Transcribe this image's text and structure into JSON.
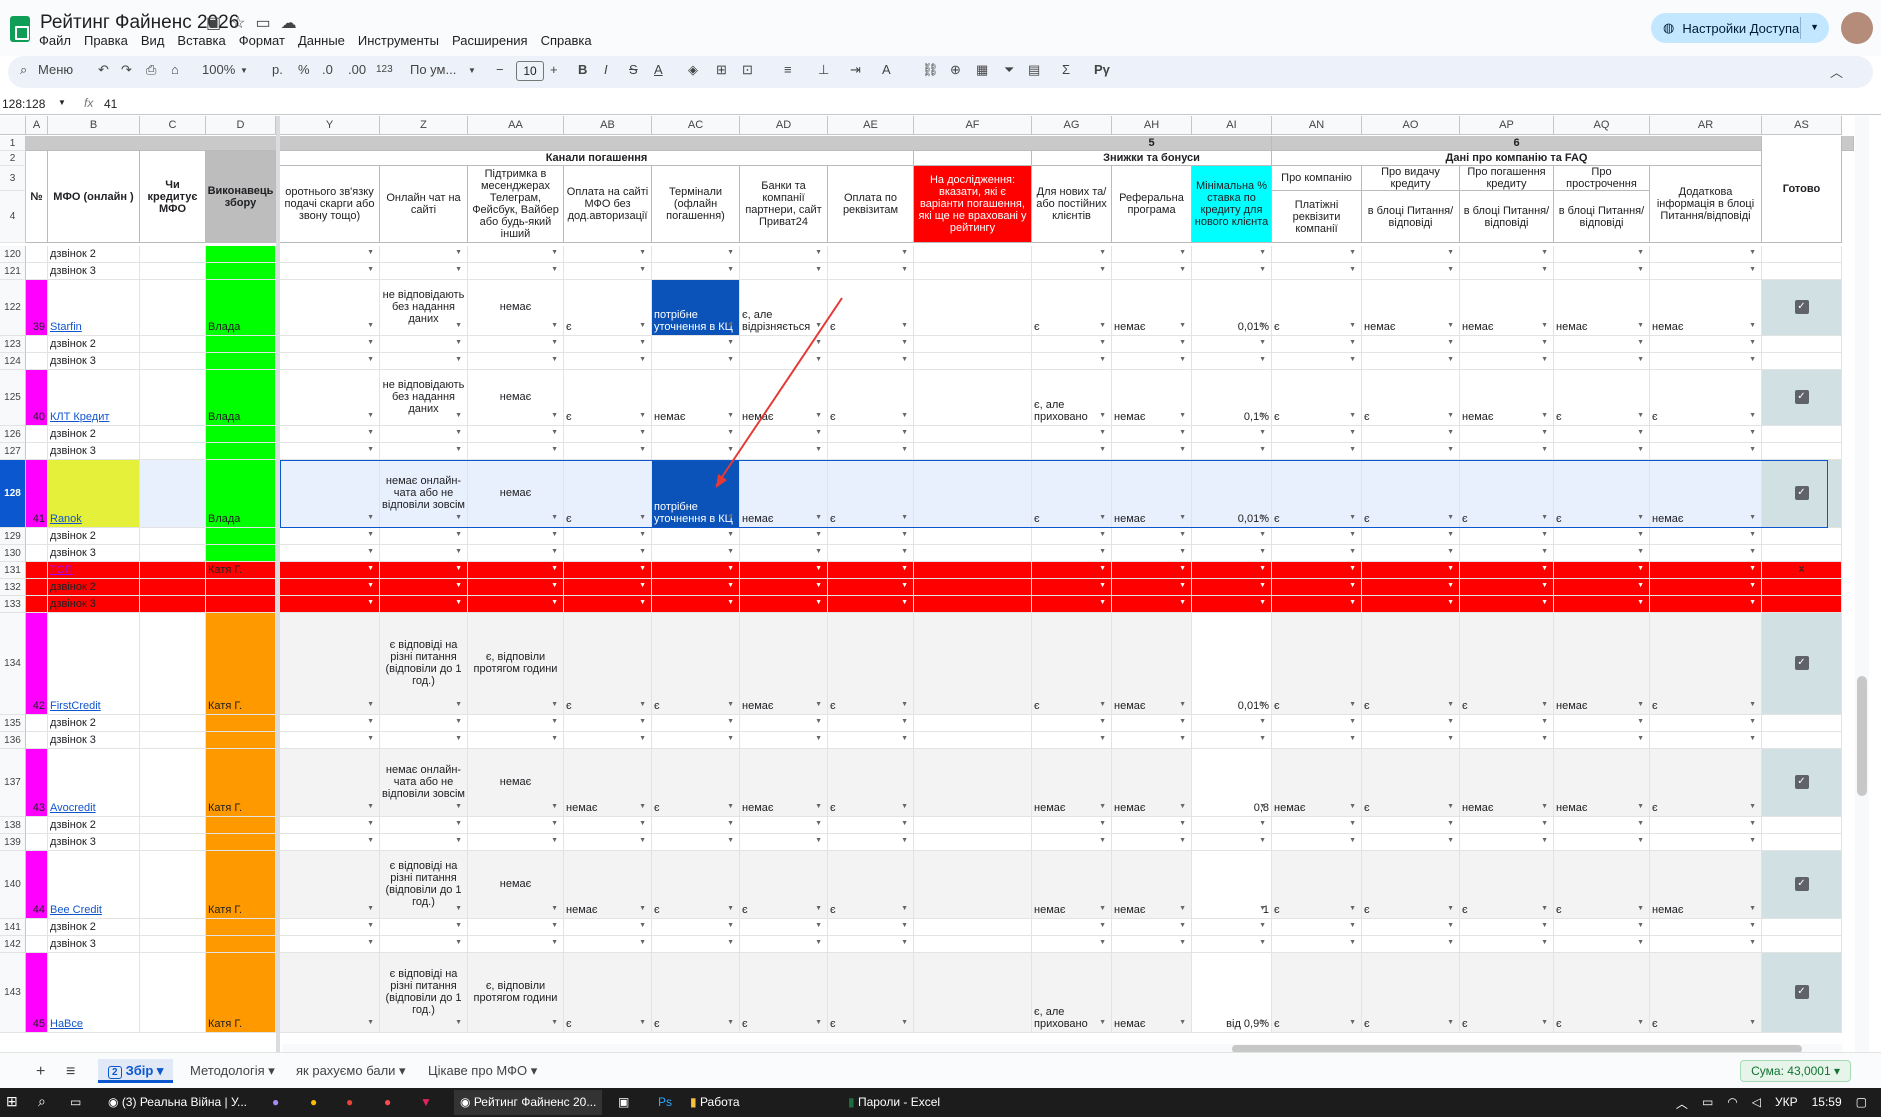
{
  "app": {
    "title": "Рейтинг Файненс 2026",
    "menus": [
      "Файл",
      "Правка",
      "Вид",
      "Вставка",
      "Формат",
      "Данные",
      "Инструменты",
      "Расширения",
      "Справка"
    ],
    "share_label": "Настройки Доступа"
  },
  "toolbar": {
    "search": "Меню",
    "zoom": "100%",
    "currency": "р.",
    "percent": "%",
    "dec_less": ".0",
    "dec_more": ".00",
    "num_format": "123",
    "font": "По ум...",
    "font_size": "10",
    "script_label": "Pγ"
  },
  "formula": {
    "namebox": "128:128",
    "fx": "fx",
    "value": "41"
  },
  "columns": [
    "A",
    "B",
    "C",
    "D",
    "Y",
    "Z",
    "AA",
    "AB",
    "AC",
    "AD",
    "AE",
    "AF",
    "AG",
    "AH",
    "AI",
    "AN",
    "AO",
    "AP",
    "AQ",
    "AR",
    "AS"
  ],
  "header": {
    "row1_5": "5",
    "row1_6": "6",
    "group_channels": "Канали погашення",
    "group_discounts": "Знижки та бонуси",
    "group_company": "Дані про компанію та FAQ",
    "num": "№",
    "mfo": "МФО (онлайн )",
    "credit": "Чи кредитує МФО",
    "executor": "Виконавець збору",
    "y": "оротнього зв'язку подачі скарги або звону тощо)",
    "z": "Онлайн чат на сайті",
    "aa": "Підтримка в месенджерах Телеграм, Фейсбук, Вайбер або будь-який інший",
    "ab": "Оплата на сайті МФО без дод.авторизації",
    "ac": "Термінали (офлайн погашення)",
    "ad": "Банки та компанії партнери, сайт Приват24",
    "ae": "Оплата по реквізитам",
    "af": "На дослідження: вказати, які є варіанти погашення, які ще не враховані у рейтингу",
    "ag": "Для нових та/або постійних клієнтів",
    "ah": "Реферальна програма",
    "ai": "Мінімальна % ставка по кредиту для нового клієнта",
    "an_top": "Про компанію",
    "an_bot": "Платіжні реквізити компанії",
    "ao_top": "Про видачу кредиту",
    "ao_bot": "в блоці Питання/відповіді",
    "ap_top": "Про погашення кредиту",
    "ap_bot": "в блоці Питання/відповіді",
    "aq_top": "Про прострочення",
    "aq_bot": "в блоці Питання/відповіді",
    "ar": "Додаткова інформація в блоці Питання/відповіді",
    "as": "Готово"
  },
  "rows": [
    {
      "n": "120",
      "b": "дзвінок 2"
    },
    {
      "n": "121",
      "b": "дзвінок 3"
    },
    {
      "n": "122",
      "a": "39",
      "b": "Starfin",
      "d": "Влада",
      "z": "не відповідають без надання даних",
      "aa": "немає",
      "ab": "є",
      "ac": "потрібне уточнення в КЦ",
      "ad": "є, але відрізняється",
      "ae": "є",
      "ag": "є",
      "ah": "немає",
      "ai": "0,01%",
      "an": "є",
      "ao": "немає",
      "ap": "немає",
      "aq": "немає",
      "ar": "немає"
    },
    {
      "n": "123",
      "b": "дзвінок 2"
    },
    {
      "n": "124",
      "b": "дзвінок 3"
    },
    {
      "n": "125",
      "a": "40",
      "b": "КЛТ Кредит",
      "d": "Влада",
      "z": "не відповідають без надання даних",
      "aa": "немає",
      "ab": "є",
      "ac": "немає",
      "ad": "немає",
      "ae": "є",
      "ag": "є, але приховано",
      "ah": "немає",
      "ai": "0,1%",
      "an": "є",
      "ao": "є",
      "ap": "немає",
      "aq": "є",
      "ar": "є"
    },
    {
      "n": "126",
      "b": "дзвінок 2"
    },
    {
      "n": "127",
      "b": "дзвінок 3"
    },
    {
      "n": "128",
      "a": "41",
      "b": "Ranok",
      "d": "Влада",
      "z": "немає онлайн-чата або не відповіли зовсім",
      "aa": "немає",
      "ab": "є",
      "ac": "потрібне уточнення в КЦ",
      "ad": "немає",
      "ae": "є",
      "ag": "є",
      "ah": "немає",
      "ai": "0,01%",
      "an": "є",
      "ao": "є",
      "ap": "є",
      "aq": "є",
      "ar": "немає"
    },
    {
      "n": "129",
      "b": "дзвінок 2"
    },
    {
      "n": "130",
      "b": "дзвінок 3"
    },
    {
      "n": "131",
      "b": "ТОП",
      "d": "Катя Г.",
      "as": "x"
    },
    {
      "n": "132",
      "b": "дзвінок 2"
    },
    {
      "n": "133",
      "b": "дзвінок 3"
    },
    {
      "n": "134",
      "a": "42",
      "b": "FirstCredit",
      "d": "Катя Г.",
      "z": "є відповіді на різні питання (відповіли до 1 год.)",
      "aa": "є, відповіли протягом години",
      "ab": "є",
      "ac": "є",
      "ad": "немає",
      "ae": "є",
      "ag": "є",
      "ah": "немає",
      "ai": "0,01%",
      "an": "є",
      "ao": "є",
      "ap": "є",
      "aq": "немає",
      "ar": "є"
    },
    {
      "n": "135",
      "b": "дзвінок 2"
    },
    {
      "n": "136",
      "b": "дзвінок 3"
    },
    {
      "n": "137",
      "a": "43",
      "b": "Avocredit",
      "d": "Катя Г.",
      "z": "немає онлайн-чата або не відповіли зовсім",
      "aa": "немає",
      "ab": "немає",
      "ac": "є",
      "ad": "немає",
      "ae": "є",
      "ag": "немає",
      "ah": "немає",
      "ai": "0,8",
      "an": "немає",
      "ao": "є",
      "ap": "немає",
      "aq": "немає",
      "ar": "є"
    },
    {
      "n": "138",
      "b": "дзвінок 2"
    },
    {
      "n": "139",
      "b": "дзвінок 3"
    },
    {
      "n": "140",
      "a": "44",
      "b": "Bee Credit",
      "d": "Катя Г.",
      "z": "є відповіді на різні питання (відповіли до 1 год.)",
      "aa": "немає",
      "ab": "немає",
      "ac": "є",
      "ad": "є",
      "ae": "є",
      "ag": "немає",
      "ah": "немає",
      "ai": "1",
      "an": "є",
      "ao": "є",
      "ap": "є",
      "aq": "є",
      "ar": "немає"
    },
    {
      "n": "141",
      "b": "дзвінок 2"
    },
    {
      "n": "142",
      "b": "дзвінок 3"
    },
    {
      "n": "143",
      "a": "45",
      "b": "НаВсе",
      "d": "Катя Г.",
      "z": "є відповіді на різні питання (відповіли до 1 год.)",
      "aa": "є, відповіли протягом години",
      "ab": "є",
      "ac": "є",
      "ad": "є",
      "ae": "є",
      "ag": "є, але приховано",
      "ah": "немає",
      "ai": "від 0,9%",
      "an": "є",
      "ao": "є",
      "ap": "є",
      "aq": "є",
      "ar": "є"
    }
  ],
  "sheets": [
    "Збір",
    "Методологія",
    "як рахуємо бали",
    "Цікаве про МФО"
  ],
  "sheet_badge": "2",
  "sum": "Сума: 43,0001",
  "taskbar": {
    "items": [
      "(3) Реальна Війна | У...",
      "Рейтинг Файненс 20...",
      "Работа",
      "Пароли - Excel"
    ],
    "lang": "УКР",
    "time": "15:59"
  },
  "colors": {
    "magenta": "#ff00ff",
    "green": "#00ff00",
    "yellow": "#e5f03b",
    "orange": "#ff9900",
    "red": "#ff0000",
    "cyan": "#00ffff",
    "blue": "#0b53b8",
    "selection": "#e8f0fe"
  }
}
